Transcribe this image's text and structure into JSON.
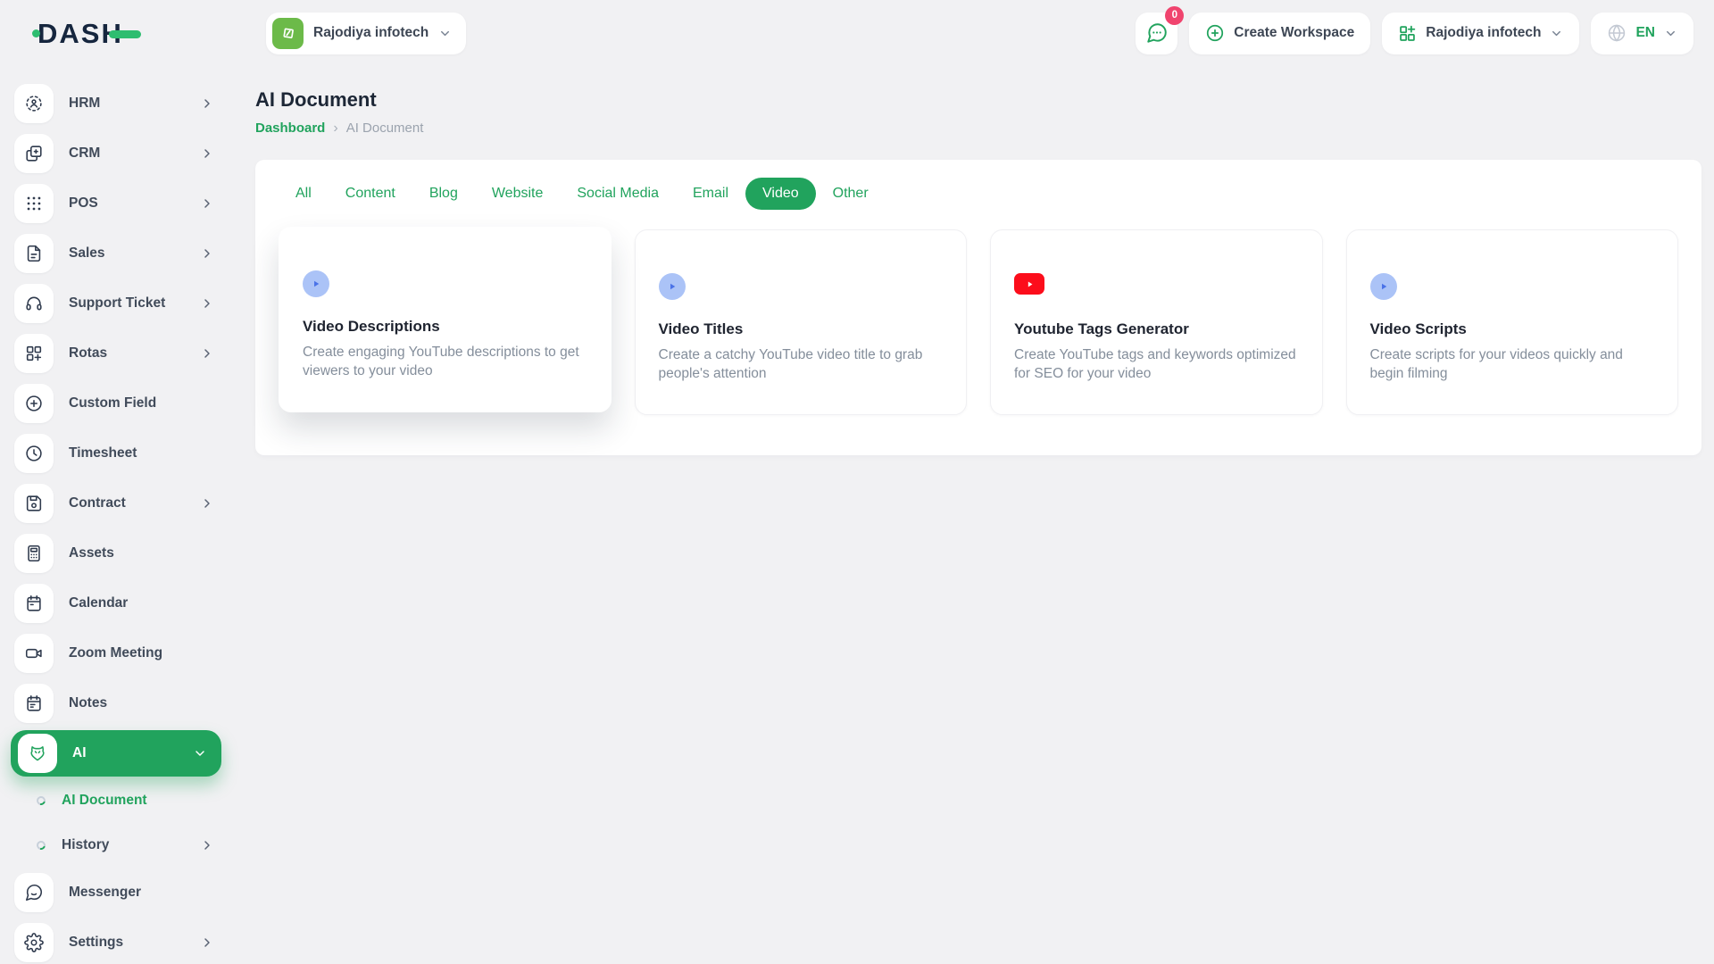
{
  "colors": {
    "accent": "#21a35d",
    "accent_bright": "#2ebd70",
    "navy": "#16263e",
    "badge_pink": "#f0446e",
    "youtube_red": "#fc0d1b",
    "play_blue": "#4a72e8",
    "play_blue_bg": "#abc3f7"
  },
  "brand": {
    "logo_text": "DASH"
  },
  "header": {
    "workspace_selector": {
      "label": "Rajodiya infotech",
      "icon": "workspace-logo-icon"
    },
    "messages_badge": "0",
    "create_workspace_label": "Create Workspace",
    "company_selector": {
      "label": "Rajodiya infotech"
    },
    "language_selector": {
      "label": "EN"
    },
    "icons": {
      "messages": "chat-bubble-icon",
      "create": "plus-circle-icon",
      "company": "org-grid-icon",
      "language": "globe-icon"
    }
  },
  "sidebar": {
    "items": [
      {
        "label": "HRM",
        "icon": "hrm-icon",
        "chevron": true
      },
      {
        "label": "CRM",
        "icon": "crm-icon",
        "chevron": true
      },
      {
        "label": "POS",
        "icon": "pos-icon",
        "chevron": true
      },
      {
        "label": "Sales",
        "icon": "sales-icon",
        "chevron": true
      },
      {
        "label": "Support Ticket",
        "icon": "support-ticket-icon",
        "chevron": true
      },
      {
        "label": "Rotas",
        "icon": "rotas-icon",
        "chevron": true
      },
      {
        "label": "Custom Field",
        "icon": "custom-field-icon"
      },
      {
        "label": "Timesheet",
        "icon": "timesheet-icon"
      },
      {
        "label": "Contract",
        "icon": "contract-icon",
        "chevron": true
      },
      {
        "label": "Assets",
        "icon": "assets-icon"
      },
      {
        "label": "Calendar",
        "icon": "calendar-icon"
      },
      {
        "label": "Zoom Meeting",
        "icon": "zoom-meeting-icon"
      },
      {
        "label": "Notes",
        "icon": "notes-icon"
      },
      {
        "label": "AI",
        "icon": "ai-icon",
        "chevron": true,
        "active": true,
        "expanded": true
      },
      {
        "label": "AI Document",
        "type": "sub",
        "active": true
      },
      {
        "label": "History",
        "type": "sub",
        "chevron": true
      },
      {
        "label": "Messenger",
        "icon": "messenger-icon"
      },
      {
        "label": "Settings",
        "icon": "settings-icon",
        "chevron": true
      }
    ]
  },
  "page": {
    "title": "AI Document",
    "breadcrumb": {
      "home": "Dashboard",
      "current": "AI Document"
    }
  },
  "tabs": [
    {
      "label": "All"
    },
    {
      "label": "Content"
    },
    {
      "label": "Blog"
    },
    {
      "label": "Website"
    },
    {
      "label": "Social Media"
    },
    {
      "label": "Email"
    },
    {
      "label": "Video",
      "active": true
    },
    {
      "label": "Other"
    }
  ],
  "cards": [
    {
      "title": "Video Descriptions",
      "description": "Create engaging YouTube descriptions to get viewers to your video",
      "icon": "play-circle-icon",
      "elevated": true
    },
    {
      "title": "Video Titles",
      "description": "Create a catchy YouTube video title to grab people's attention",
      "icon": "play-circle-icon"
    },
    {
      "title": "Youtube Tags Generator",
      "description": "Create YouTube tags and keywords optimized for SEO for your video",
      "icon": "youtube-icon"
    },
    {
      "title": "Video Scripts",
      "description": "Create scripts for your videos quickly and begin filming",
      "icon": "play-circle-icon"
    }
  ]
}
